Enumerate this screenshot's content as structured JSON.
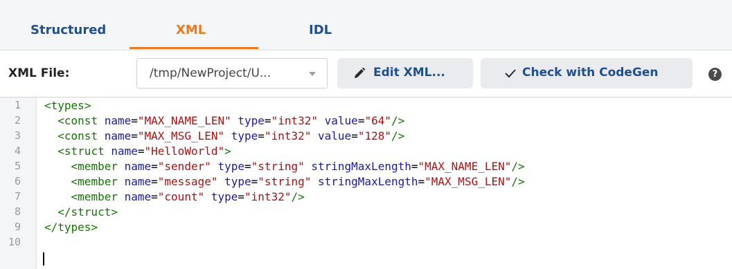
{
  "tabs": [
    {
      "label": "Structured",
      "active": false
    },
    {
      "label": "XML",
      "active": true
    },
    {
      "label": "IDL",
      "active": false
    }
  ],
  "toolbar": {
    "file_label": "XML File:",
    "file_value": "/tmp/NewProject/U...",
    "edit_label": "Edit XML...",
    "check_label": "Check with CodeGen",
    "help_label": "?"
  },
  "editor": {
    "line_numbers": [
      "1",
      "2",
      "3",
      "4",
      "5",
      "6",
      "7",
      "8",
      "9",
      "10"
    ],
    "lines": [
      "<types>",
      "  <const name=\"MAX_NAME_LEN\" type=\"int32\" value=\"64\"/>",
      "  <const name=\"MAX_MSG_LEN\" type=\"int32\" value=\"128\"/>",
      "  <struct name=\"HelloWorld\">",
      "    <member name=\"sender\" type=\"string\" stringMaxLength=\"MAX_NAME_LEN\"/>",
      "    <member name=\"message\" type=\"string\" stringMaxLength=\"MAX_MSG_LEN\"/>",
      "    <member name=\"count\" type=\"int32\"/>",
      "  </struct>",
      "</types>",
      ""
    ]
  },
  "colors": {
    "tab_text": "#1f4f8f",
    "tab_active": "#ea7a1f",
    "xml_tag": "#117700",
    "xml_attr": "#1a1aa6",
    "xml_string": "#aa1111"
  },
  "icons": {
    "edit": "pencil-icon",
    "check": "checkmark-icon",
    "help": "help-icon",
    "dropdown": "chevron-down-icon"
  }
}
